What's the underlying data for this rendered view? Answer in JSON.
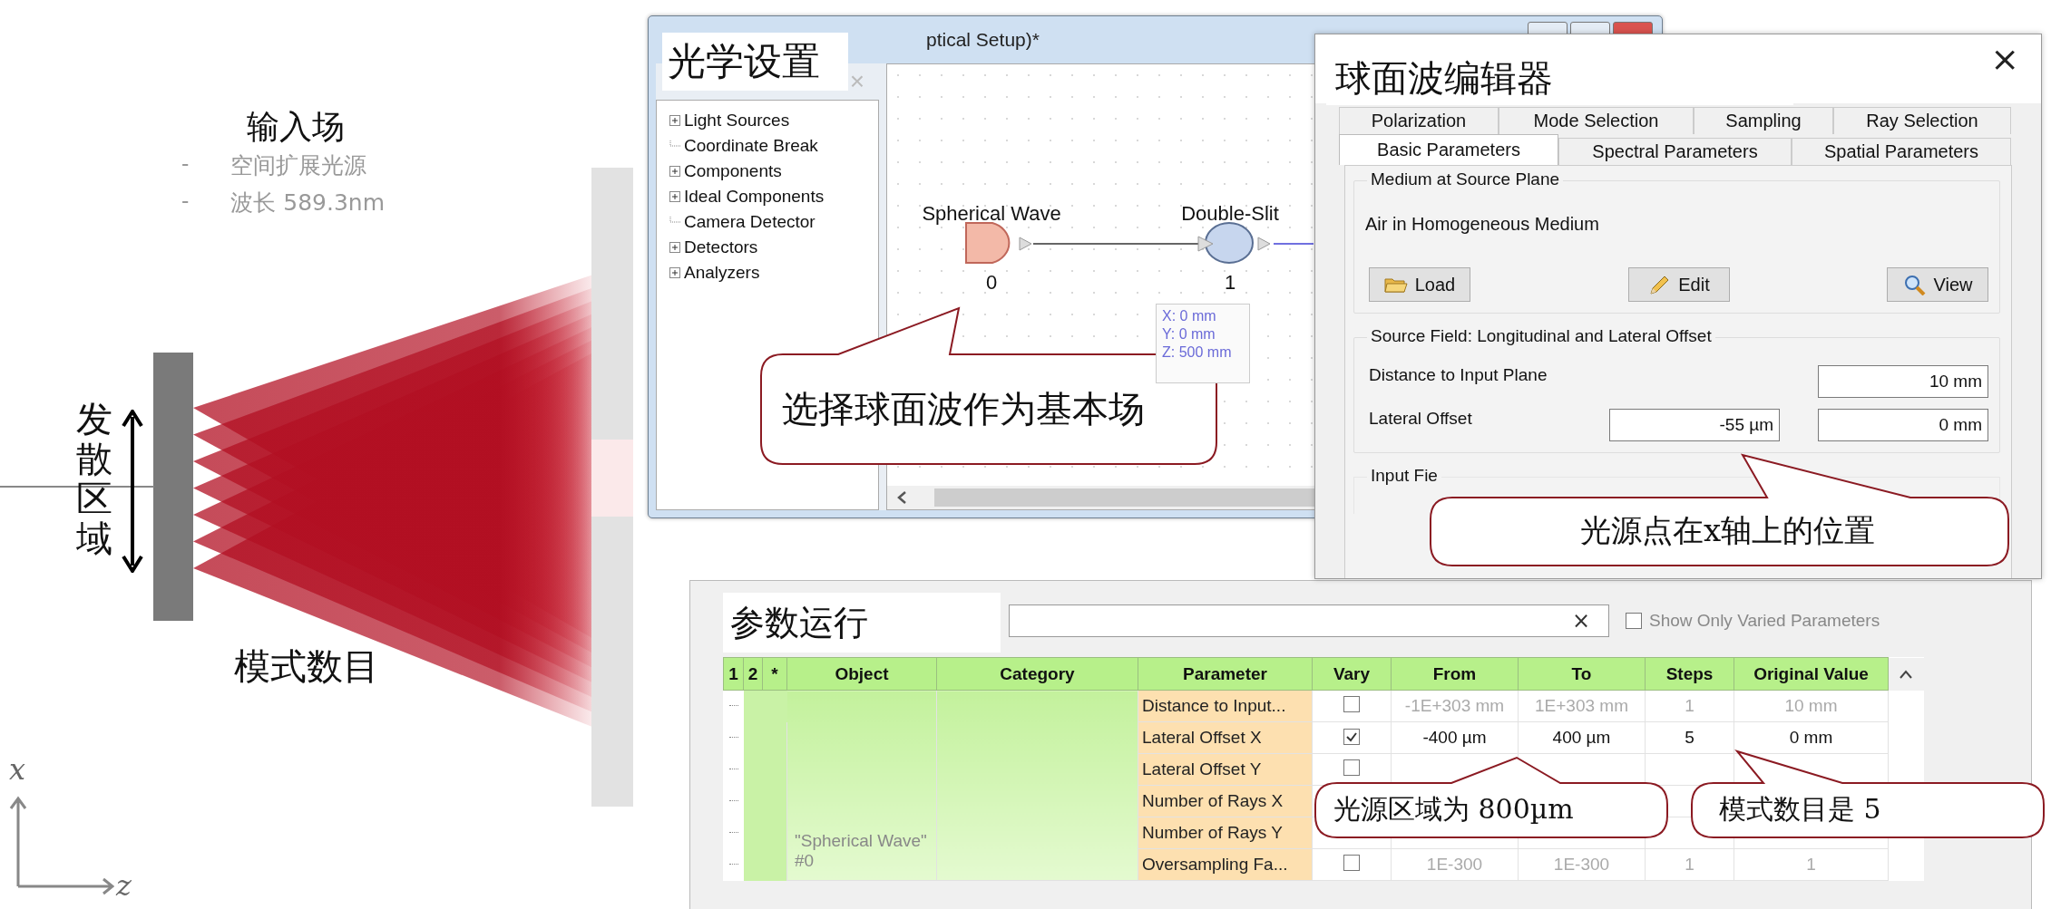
{
  "slide": {
    "heading": "输入场",
    "bullets": [
      {
        "marker": "-",
        "text": "空间扩展光源"
      },
      {
        "marker": "-",
        "text": "波长 589.3nm"
      }
    ],
    "region_label": "发散区域",
    "mode_label": "模式数目",
    "axis_labels": {
      "x": "x",
      "z": "z"
    }
  },
  "optical_setup": {
    "title": "ptical Setup)*",
    "overlay_label": "光学设置",
    "panel_close": "×",
    "tree": [
      {
        "label": "Light Sources",
        "kind": "folder"
      },
      {
        "label": "Coordinate Break",
        "kind": "leaf"
      },
      {
        "label": "Components",
        "kind": "folder"
      },
      {
        "label": "Ideal Components",
        "kind": "folder"
      },
      {
        "label": "Camera Detector",
        "kind": "leaf"
      },
      {
        "label": "Detectors",
        "kind": "folder"
      },
      {
        "label": "Analyzers",
        "kind": "folder"
      }
    ],
    "nodes": [
      {
        "label": "Spherical Wave",
        "number": "0",
        "kind": "source"
      },
      {
        "label": "Double-Slit",
        "number": "1",
        "kind": "component"
      }
    ],
    "tooltip": [
      "X: 0 mm",
      "Y: 0 mm",
      "Z: 500 mm"
    ],
    "callout": "选择球面波作为基本场"
  },
  "editor": {
    "overlay_label": "球面波编辑器",
    "close": "×",
    "tab_rows": [
      [
        {
          "label": "Polarization",
          "selected": false
        },
        {
          "label": "Mode Selection",
          "selected": false
        },
        {
          "label": "Sampling",
          "selected": false
        },
        {
          "label": "Ray Selection",
          "selected": false
        }
      ],
      [
        {
          "label": "Basic Parameters",
          "selected": true
        },
        {
          "label": "Spectral Parameters",
          "selected": false
        },
        {
          "label": "Spatial Parameters",
          "selected": false
        }
      ]
    ],
    "medium": {
      "legend": "Medium at Source Plane",
      "value": "Air in Homogeneous Medium",
      "buttons": [
        {
          "label": "Load"
        },
        {
          "label": "Edit"
        },
        {
          "label": "View"
        }
      ]
    },
    "source_field": {
      "legend": "Source Field: Longitudinal and Lateral Offset",
      "rows": [
        {
          "label": "Distance to Input Plane",
          "values": [
            "10 mm"
          ]
        },
        {
          "label": "Lateral Offset",
          "values": [
            "-55 µm",
            "0 mm"
          ]
        }
      ]
    },
    "input_field": {
      "legend": "Input Fie"
    },
    "callout": "光源点在x轴上的位置"
  },
  "parameter_run": {
    "overlay_label": "参数运行",
    "search_clear": "×",
    "varied_only": {
      "label": "Show Only Varied Parameters",
      "checked": false
    },
    "columns": [
      "1",
      "2",
      "*",
      "Object",
      "Category",
      "Parameter",
      "Vary",
      "From",
      "To",
      "Steps",
      "Original Value"
    ],
    "object": "\"Spherical Wave\" #0",
    "rows": [
      {
        "parameter": "Distance to Input...",
        "vary": false,
        "from": "-1E+303 mm",
        "to": "1E+303 mm",
        "steps": "1",
        "original": "10 mm"
      },
      {
        "parameter": "Lateral Offset X",
        "vary": true,
        "from": "-400 µm",
        "to": "400 µm",
        "steps": "5",
        "original": "0 mm"
      },
      {
        "parameter": "Lateral Offset Y",
        "vary": false
      },
      {
        "parameter": "Number of Rays X"
      },
      {
        "parameter": "Number of Rays Y"
      },
      {
        "parameter": "Oversampling Fa...",
        "vary": false,
        "from": "1E-300",
        "to": "1E-300",
        "steps": "1",
        "original": "1"
      }
    ],
    "callouts": [
      "光源区域为 800µm",
      "模式数目是 5"
    ]
  }
}
